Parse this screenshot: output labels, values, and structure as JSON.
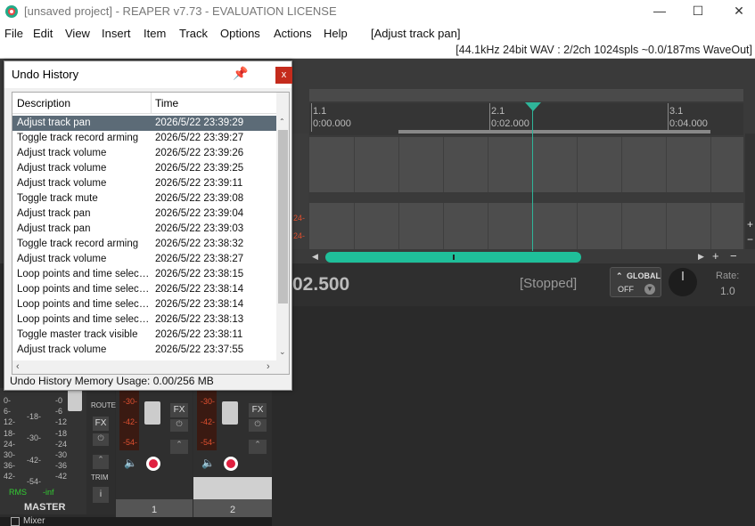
{
  "window": {
    "title": "[unsaved project] - REAPER v7.73 - EVALUATION LICENSE",
    "min": "—",
    "max": "☐",
    "close": "✕"
  },
  "menu": [
    "File",
    "Edit",
    "View",
    "Insert",
    "Item",
    "Track",
    "Options",
    "Actions",
    "Help"
  ],
  "menu_action": "[Adjust track pan]",
  "status": "[44.1kHz 24bit WAV : 2/2ch 1024spls ~0.0/187ms WaveOut]",
  "ruler": [
    {
      "bar": "1.1",
      "time": "0:00.000"
    },
    {
      "bar": "2.1",
      "time": "0:02.000"
    },
    {
      "bar": "3.1",
      "time": "0:04.000"
    }
  ],
  "transport": {
    "position": "02.500",
    "state": "[Stopped]",
    "global": "GLOBAL",
    "off": "OFF",
    "rate_label": "Rate:",
    "rate": "1.0"
  },
  "undo": {
    "title": "Undo History",
    "close": "x",
    "columns": [
      "Description",
      "Time"
    ],
    "rows": [
      {
        "d": "Adjust track pan",
        "t": "2026/5/22 23:39:29"
      },
      {
        "d": "Toggle track record arming",
        "t": "2026/5/22 23:39:27"
      },
      {
        "d": "Adjust track volume",
        "t": "2026/5/22 23:39:26"
      },
      {
        "d": "Adjust track volume",
        "t": "2026/5/22 23:39:25"
      },
      {
        "d": "Adjust track volume",
        "t": "2026/5/22 23:39:11"
      },
      {
        "d": "Toggle track mute",
        "t": "2026/5/22 23:39:08"
      },
      {
        "d": "Adjust track pan",
        "t": "2026/5/22 23:39:04"
      },
      {
        "d": "Adjust track pan",
        "t": "2026/5/22 23:39:03"
      },
      {
        "d": "Toggle track record arming",
        "t": "2026/5/22 23:38:32"
      },
      {
        "d": "Adjust track volume",
        "t": "2026/5/22 23:38:27"
      },
      {
        "d": "Loop points and time selectio...",
        "t": "2026/5/22 23:38:15"
      },
      {
        "d": "Loop points and time selectio...",
        "t": "2026/5/22 23:38:14"
      },
      {
        "d": "Loop points and time selectio...",
        "t": "2026/5/22 23:38:14"
      },
      {
        "d": "Loop points and time selectio...",
        "t": "2026/5/22 23:38:13"
      },
      {
        "d": "Toggle master track visible",
        "t": "2026/5/22 23:38:11"
      },
      {
        "d": "Adjust track volume",
        "t": "2026/5/22 23:37:55"
      }
    ],
    "memory": "Undo History Memory Usage: 0.00/256 MB"
  },
  "mixer": {
    "master": "MASTER",
    "rms": "RMS",
    "inf": "-inf",
    "route": "ROUTE",
    "fx": "FX",
    "trim": "TRIM",
    "track1": "1",
    "track2": "2",
    "tab": "Mixer",
    "master_scale_left": [
      "0-",
      "6-",
      "12-",
      "18-",
      "24-",
      "30-",
      "36-",
      "42-"
    ],
    "master_scale_mid": [
      "-18-",
      "-30-",
      "-42-",
      "-54-"
    ],
    "master_scale_right": [
      "-0",
      "-6",
      "-12",
      "-18",
      "-24",
      "-30",
      "-36",
      "-42"
    ],
    "track_meter": [
      "-30-",
      "-42-",
      "-54-"
    ]
  }
}
